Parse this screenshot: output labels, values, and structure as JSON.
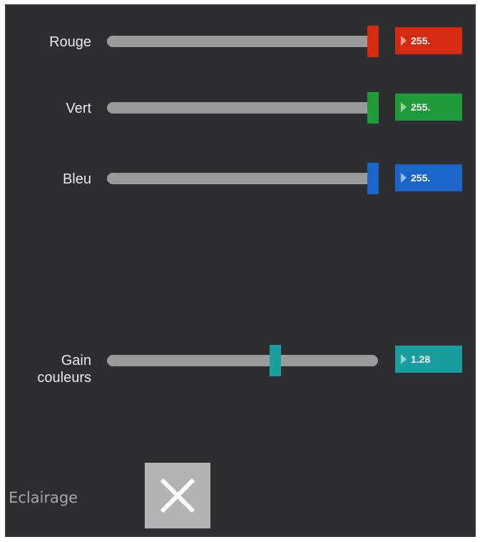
{
  "sliders": [
    {
      "label": "Rouge",
      "value": "255.",
      "color": "#d42a12",
      "level": 1.0
    },
    {
      "label": "Vert",
      "value": "255.",
      "color": "#1f9a39",
      "level": 1.0
    },
    {
      "label": "Bleu",
      "value": "255.",
      "color": "#1a64c8",
      "level": 1.0
    },
    {
      "label": "Gain couleurs",
      "label_line1": "Gain",
      "label_line2": "couleurs",
      "value": "1.28",
      "color": "#1a9ea0",
      "level": 0.62
    }
  ],
  "lighting": {
    "label": "Eclairage",
    "toggle_icon": "close-icon",
    "toggle_state": "off"
  }
}
